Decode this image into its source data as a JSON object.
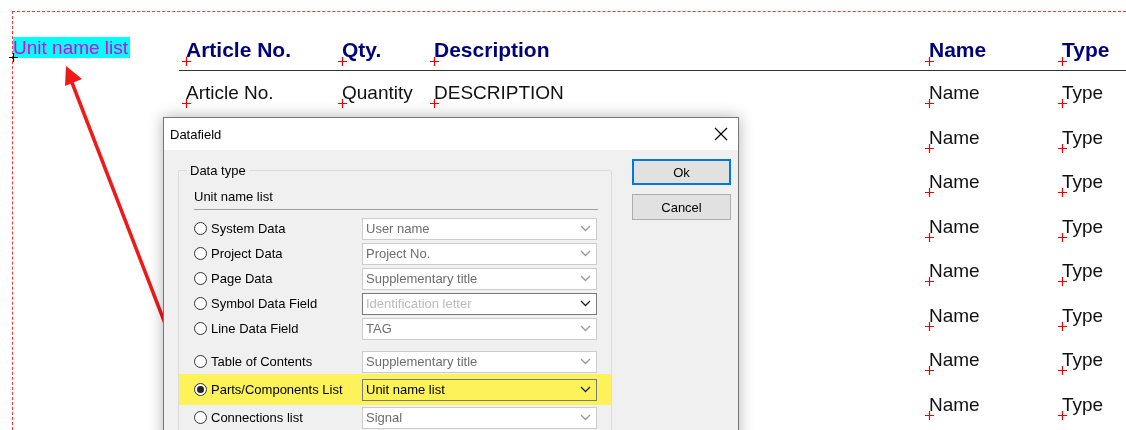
{
  "canvas": {
    "label": "Unit name list",
    "table": {
      "columns": [
        "Article No.",
        "Qty.",
        "Description",
        "Name",
        "Type"
      ],
      "rows": [
        {
          "cells": [
            "Article No.",
            "Quantity",
            "DESCRIPTION",
            "Name",
            "Type"
          ]
        },
        {
          "cells": [
            null,
            null,
            null,
            "Name",
            "Type"
          ]
        },
        {
          "cells": [
            null,
            null,
            null,
            "Name",
            "Type"
          ]
        },
        {
          "cells": [
            null,
            null,
            null,
            "Name",
            "Type"
          ]
        },
        {
          "cells": [
            null,
            null,
            null,
            "Name",
            "Type"
          ]
        },
        {
          "cells": [
            null,
            null,
            null,
            "Name",
            "Type"
          ]
        },
        {
          "cells": [
            null,
            null,
            null,
            "Name",
            "Type"
          ]
        },
        {
          "cells": [
            null,
            null,
            null,
            "Name",
            "Type"
          ]
        }
      ]
    }
  },
  "dialog": {
    "title": "Datafield",
    "group_title": "Data type",
    "subheading": "Unit name list",
    "options": [
      {
        "label": "System Data",
        "selected": false,
        "value": "User name",
        "disabled": true,
        "highlighted": false
      },
      {
        "label": "Project Data",
        "selected": false,
        "value": "Project No.",
        "disabled": true,
        "highlighted": false
      },
      {
        "label": "Page Data",
        "selected": false,
        "value": "Supplementary title",
        "disabled": true,
        "highlighted": false
      },
      {
        "label": "Symbol Data Field",
        "selected": false,
        "placeholder": "Identification letter",
        "disabled": false,
        "highlighted": false
      },
      {
        "label": "Line Data Field",
        "selected": false,
        "value": "TAG",
        "disabled": true,
        "highlighted": false
      },
      {
        "label": "Table of Contents",
        "selected": false,
        "value": "Supplementary title",
        "disabled": true,
        "highlighted": false
      },
      {
        "label": "Parts/Components List",
        "selected": true,
        "value": "Unit name list",
        "disabled": false,
        "highlighted": true
      },
      {
        "label": "Connections list",
        "selected": false,
        "value": "Signal",
        "disabled": true,
        "highlighted": false
      }
    ],
    "buttons": [
      {
        "label": "Ok",
        "default": true
      },
      {
        "label": "Cancel",
        "default": false
      }
    ]
  }
}
